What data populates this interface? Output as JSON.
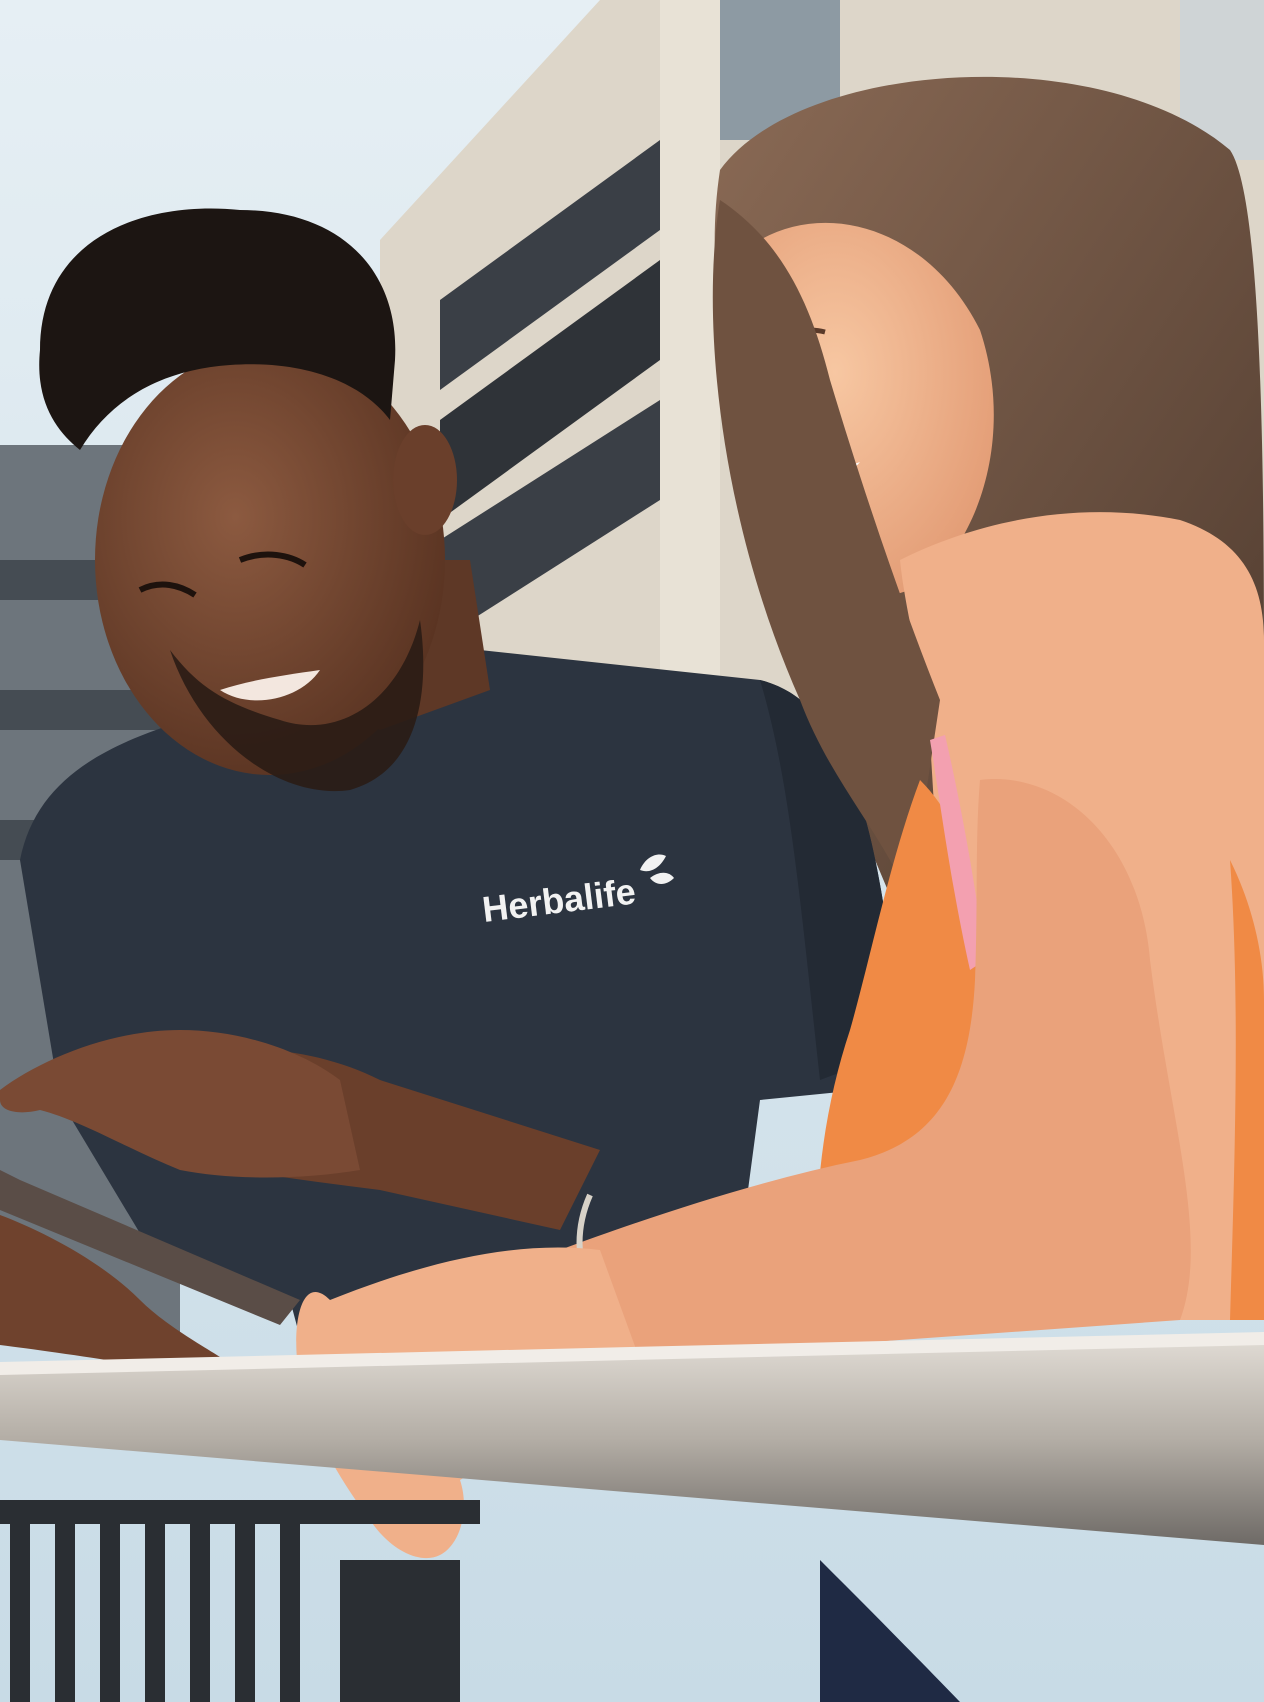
{
  "photo": {
    "shirt_logo_text": "Herbalife",
    "colors": {
      "sky": "#cfe0ea",
      "building": "#ddd6c9",
      "building_shadow": "#2f3338",
      "shirt": "#2c3440",
      "skin_man": "#7a4a34",
      "skin_woman": "#f0b48e",
      "hair_man": "#1c1512",
      "hair_woman": "#6f5240",
      "top_orange": "#f08a45",
      "top_pink": "#f3a0b0",
      "rail": "#b9b3ab",
      "fence": "#2a2e33",
      "jeans": "#1f2a44",
      "tablet": "#5a4d47"
    }
  }
}
